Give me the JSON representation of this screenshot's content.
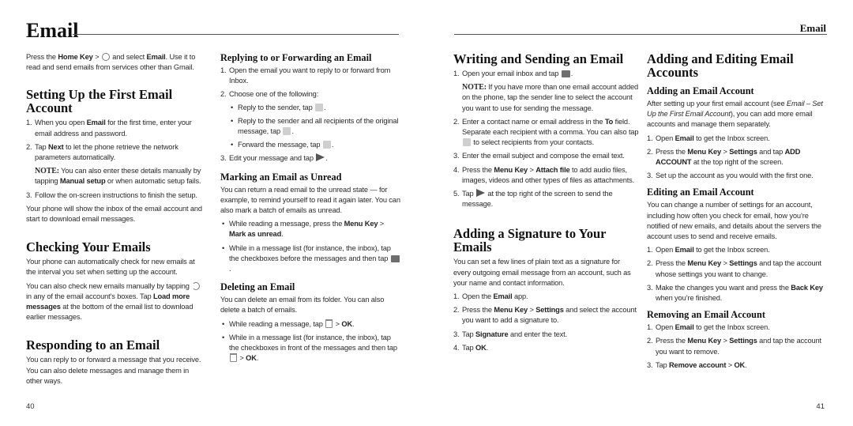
{
  "left_page": {
    "chapter_title": "Email",
    "page_number": "40",
    "intro": {
      "t1": "Press the ",
      "b1": "Home Key",
      "t2": " > ",
      "icon": "apps-menu-icon",
      "t3": " and select ",
      "b2": "Email",
      "t4": ". Use it to read and send emails from services other than Gmail."
    },
    "setup": {
      "title": "Setting Up the First Email Account",
      "step1": {
        "n": "1.",
        "t1": "When you open ",
        "b1": "Email",
        "t2": " for the first time, enter your email address and password."
      },
      "step2": {
        "n": "2.",
        "t1": "Tap ",
        "b1": "Next",
        "t2": " to let the phone retrieve the network parameters automatically."
      },
      "note": {
        "label": "NOTE:",
        "t1": " You can also enter these details manually by tapping ",
        "b1": "Manual setup",
        "t2": " or when automatic setup fails."
      },
      "step3": {
        "n": "3.",
        "t1": "Follow the on-screen instructions to finish the setup."
      },
      "after": "Your phone will show the inbox of the email account and start to download email messages."
    },
    "checking": {
      "title": "Checking Your Emails",
      "p1": "Your phone can automatically check for new emails at the interval you set when setting up the account.",
      "p2": {
        "t1": "You can also check new emails manually by tapping ",
        "icon": "refresh-icon",
        "t2": " in any of the email account’s boxes. Tap ",
        "b1": "Load more messages",
        "t3": " at the bottom of the email list to download earlier messages."
      }
    },
    "responding": {
      "title": "Responding to an Email",
      "p1": "You can reply to or forward a message that you receive. You can also delete messages and manage them in other ways."
    },
    "replying": {
      "title": "Replying to or Forwarding an Email",
      "step1": {
        "n": "1.",
        "t1": "Open the email you want to reply to or forward from Inbox."
      },
      "step2": {
        "n": "2.",
        "t1": "Choose one of the following:"
      },
      "bullets": [
        {
          "t1": "Reply to the sender, tap ",
          "icon": "reply-icon",
          "t2": "."
        },
        {
          "t1": "Reply to the sender and all recipients of the original message, tap ",
          "icon": "reply-all-icon",
          "t2": "."
        },
        {
          "t1": "Forward the message, tap ",
          "icon": "forward-icon",
          "t2": "."
        }
      ],
      "step3": {
        "n": "3.",
        "t1": "Edit your message and tap ",
        "icon": "send-icon",
        "t2": "."
      }
    },
    "unread": {
      "title": "Marking an Email as Unread",
      "p1": "You can return a read email to the unread state — for example, to remind yourself to read it again later. You can also mark a batch of emails as unread.",
      "bullets": [
        {
          "t1": "While reading a message, press the ",
          "b1": "Menu Key",
          "t2": " > ",
          "b2": "Mark as unread",
          "t3": "."
        },
        {
          "t1": "While in a message list (for instance, the inbox), tap the checkboxes before the messages and then tap ",
          "icon": "mark-unread-icon",
          "t2": "."
        }
      ]
    },
    "deleting": {
      "title": "Deleting an Email",
      "p1": "You can delete an email from its folder. You can also delete a batch of emails.",
      "bullets": [
        {
          "t1": "While reading a message, tap ",
          "icon": "trash-icon",
          "t2": " > ",
          "b1": "OK",
          "t3": "."
        },
        {
          "t1": "While in a message list (for instance, the inbox), tap the checkboxes in front of the messages and then tap ",
          "icon": "trash-icon",
          "t2": " > ",
          "b1": "OK",
          "t3": "."
        }
      ]
    }
  },
  "right_page": {
    "running_head": "Email",
    "page_number": "41",
    "writing": {
      "title": "Writing and Sending an Email",
      "step1": {
        "n": "1.",
        "t1": "Open your email inbox and tap ",
        "icon": "compose-icon",
        "t2": "."
      },
      "note": {
        "label": "NOTE:",
        "t1": " If you have more than one email account added on the phone, tap the sender line to select the account you want to use for sending the message."
      },
      "step2": {
        "n": "2.",
        "t1": "Enter a contact name or email address in the ",
        "b1": "To",
        "t2": " field. Separate each recipient with a comma. You can also tap ",
        "icon": "contacts-icon",
        "t3": " to select recipients from your contacts."
      },
      "step3": {
        "n": "3.",
        "t1": "Enter the email subject and compose the email text."
      },
      "step4": {
        "n": "4.",
        "t1": "Press the ",
        "b1": "Menu Key",
        "t2": " > ",
        "b2": "Attach file",
        "t3": " to add audio files, images, videos and other types of files as attachments."
      },
      "step5": {
        "n": "5.",
        "t1": "Tap ",
        "icon": "send-icon",
        "t2": " at the top right of the screen to send the message."
      }
    },
    "signature": {
      "title": "Adding a Signature to Your Emails",
      "p1": "You can set a few lines of plain text as a signature for every outgoing email message from an account, such as your name and contact information.",
      "step1": {
        "n": "1.",
        "t1": "Open the ",
        "b1": "Email",
        "t2": " app."
      },
      "step2": {
        "n": "2.",
        "t1": "Press the ",
        "b1": "Menu Key",
        "t2": " > ",
        "b2": "Settings",
        "t3": " and select the account you want to add a signature to."
      },
      "step3": {
        "n": "3.",
        "t1": "Tap ",
        "b1": "Signature",
        "t2": " and enter the text."
      },
      "step4": {
        "n": "4.",
        "t1": "Tap ",
        "b1": "OK",
        "t2": "."
      }
    },
    "accounts": {
      "title": "Adding and Editing Email Accounts",
      "adding": {
        "title": "Adding an Email Account",
        "p1": {
          "t1": "After setting up your first email account (see ",
          "i1": "Email – Set Up the First Email Account",
          "t2": "), you can add more email accounts and manage them separately."
        },
        "step1": {
          "n": "1.",
          "t1": "Open ",
          "b1": "Email",
          "t2": " to get the Inbox screen."
        },
        "step2": {
          "n": "2.",
          "t1": "Press the ",
          "b1": "Menu Key",
          "t2": " > ",
          "b2": "Settings",
          "t3": " and tap ",
          "b3": "ADD ACCOUNT",
          "t4": " at the top right of the screen."
        },
        "step3": {
          "n": "3.",
          "t1": "Set up the account as you would with the first one."
        }
      },
      "editing": {
        "title": "Editing an Email Account",
        "p1": "You can change a number of settings for an account, including how often you check for email, how you’re notified of new emails, and details about the servers the account uses to send and receive emails.",
        "step1": {
          "n": "1.",
          "t1": "Open ",
          "b1": "Email",
          "t2": " to get the Inbox screen."
        },
        "step2": {
          "n": "2.",
          "t1": "Press the ",
          "b1": "Menu Key",
          "t2": " > ",
          "b2": "Settings",
          "t3": " and tap the account whose settings you want to change."
        },
        "step3": {
          "n": "3.",
          "t1": "Make the changes you want and press the ",
          "b1": "Back Key",
          "t2": " when you’re finished."
        }
      },
      "removing": {
        "title": "Removing an Email Account",
        "step1": {
          "n": "1.",
          "t1": "Open ",
          "b1": "Email",
          "t2": " to get the Inbox screen."
        },
        "step2": {
          "n": "2.",
          "t1": "Press the ",
          "b1": "Menu Key",
          "t2": " > ",
          "b2": "Settings",
          "t3": " and tap the account you want to remove."
        },
        "step3": {
          "n": "3.",
          "t1": "Tap ",
          "b1": "Remove account",
          "t2": " > ",
          "b2": "OK",
          "t3": "."
        }
      }
    }
  }
}
